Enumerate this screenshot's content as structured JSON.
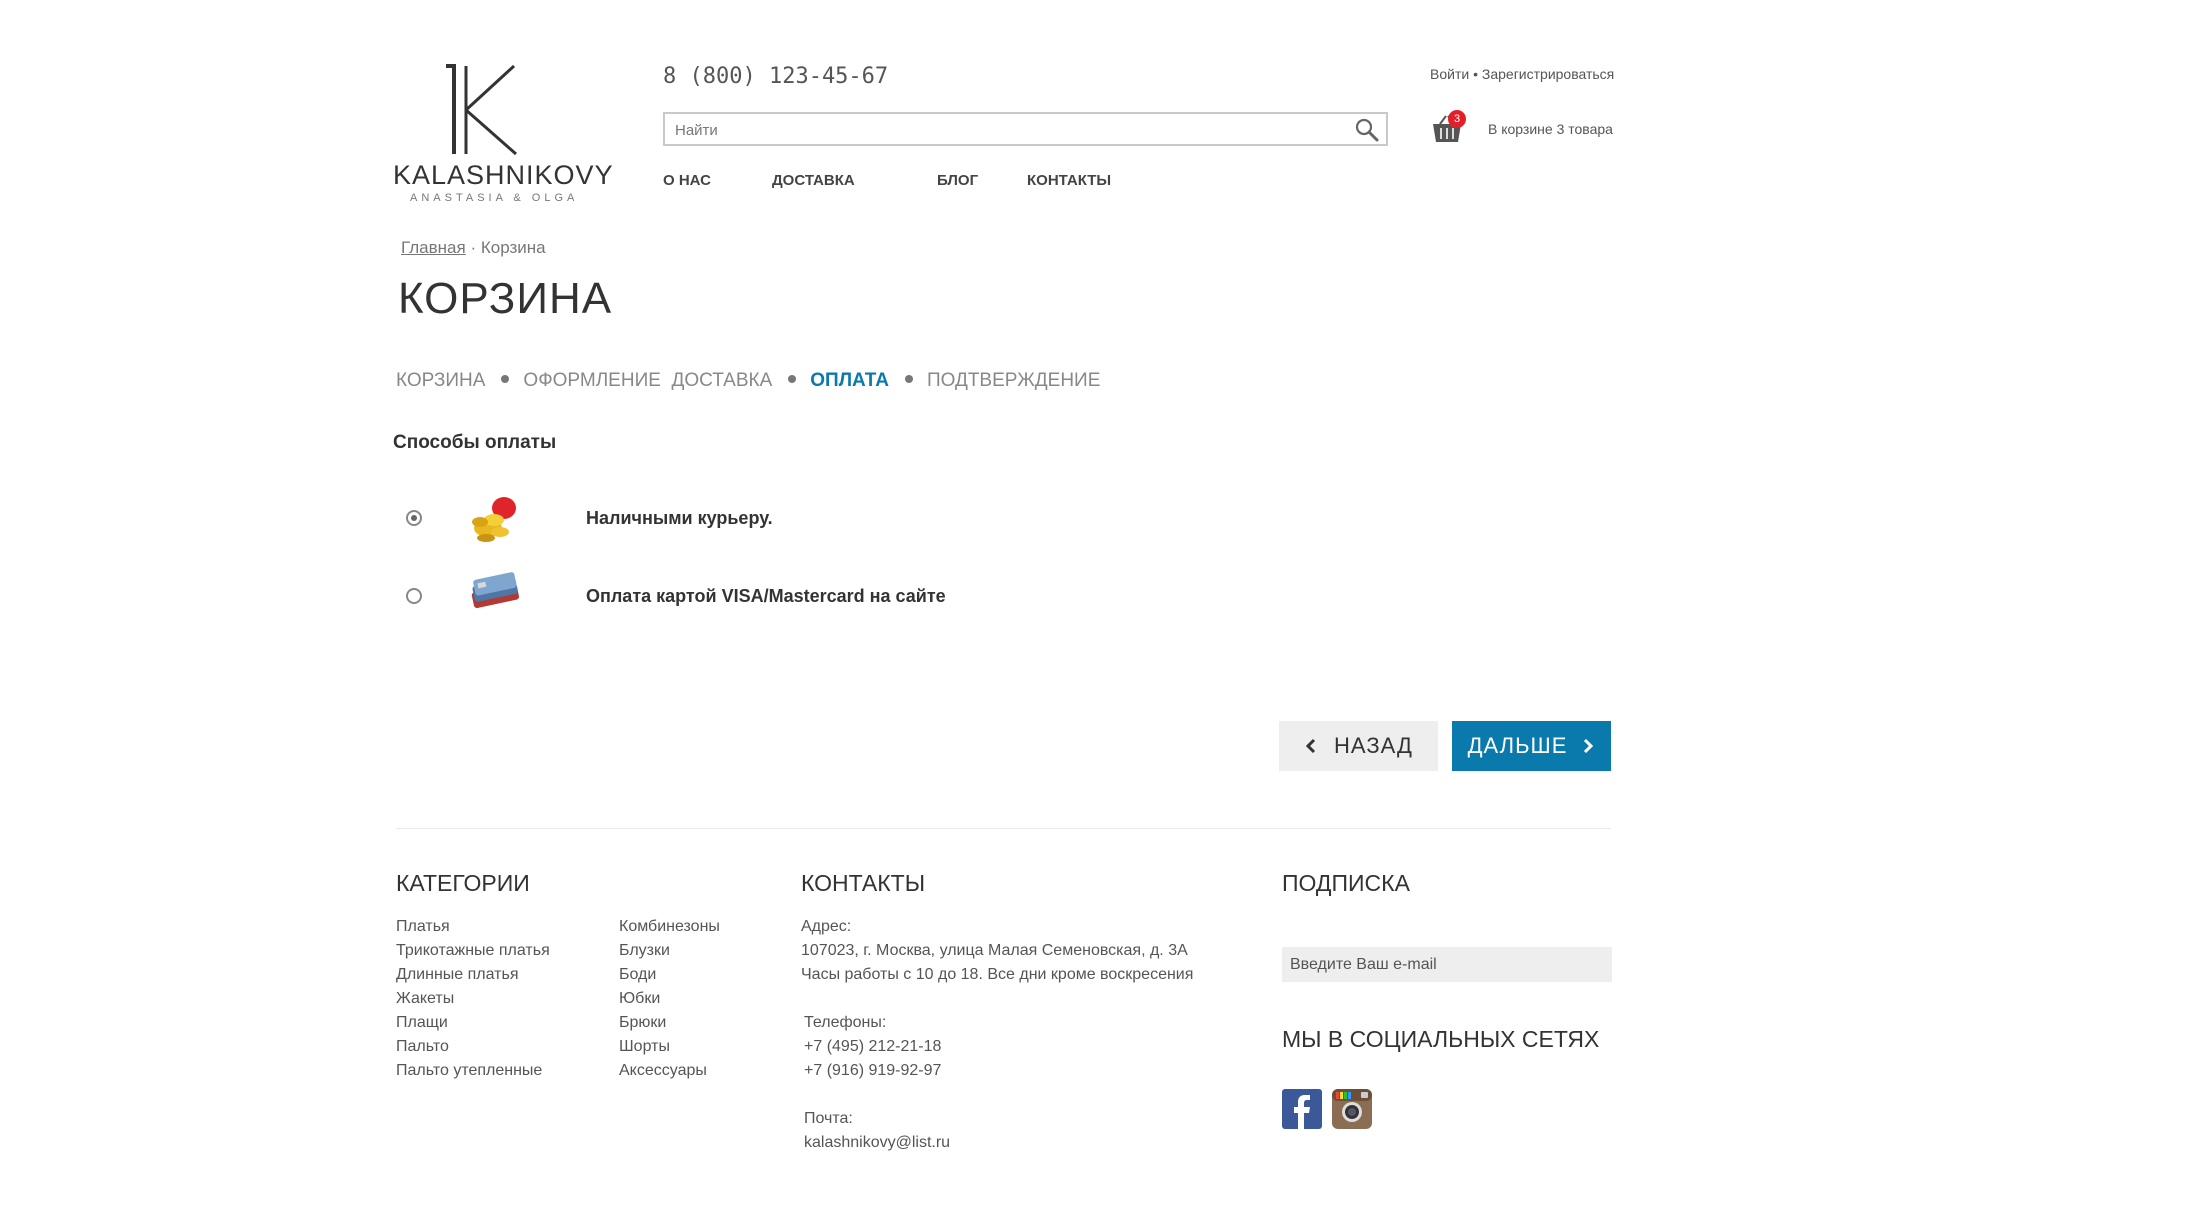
{
  "logo": {
    "name": "KALASHNIKOVY",
    "subtitle": "ANASTASIA & OLGA"
  },
  "header": {
    "phone": "8 (800) 123-45-67",
    "search_placeholder": "Найти",
    "login": "Войти",
    "separator": "•",
    "register": "Зарегистрироваться",
    "cart_count": "3",
    "cart_text": "В корзине 3 товара"
  },
  "nav": [
    "О НАС",
    "ДОСТАВКА",
    "БЛОГ",
    "КОНТАКТЫ"
  ],
  "breadcrumb": {
    "home": "Главная",
    "sep": "·",
    "current": "Корзина"
  },
  "page_title": "КОРЗИНА",
  "steps": [
    {
      "label": "КОРЗИНА",
      "active": false
    },
    {
      "label": "ОФОРМЛЕНИЕ  ДОСТАВКА",
      "active": false
    },
    {
      "label": "ОПЛАТА",
      "active": true
    },
    {
      "label": "ПОДТВЕРЖДЕНИЕ",
      "active": false
    }
  ],
  "payment": {
    "heading": "Способы оплаты",
    "methods": [
      {
        "label": "Наличными курьеру.",
        "selected": true,
        "icon": "coins-icon"
      },
      {
        "label": "Оплата картой VISA/Mastercard на сайте",
        "selected": false,
        "icon": "cards-icon"
      }
    ]
  },
  "buttons": {
    "back": "НАЗАД",
    "next": "ДАЛЬШЕ"
  },
  "footer": {
    "categories_title": "КАТЕГОРИИ",
    "categories_col1": [
      "Платья",
      "Трикотажные платья",
      "Длинные платья",
      "Жакеты",
      "Плащи",
      "Пальто",
      "Пальто утепленные"
    ],
    "categories_col2": [
      "Комбинезоны",
      "Блузки",
      "Боди",
      "Юбки",
      "Брюки",
      "Шорты",
      "Аксессуары"
    ],
    "contacts_title": "КОНТАКТЫ",
    "address_label": "Адрес:",
    "address": "107023, г. Москва, улица Малая Семеновская, д. 3А",
    "hours": "Часы работы с 10 до 18. Все дни кроме воскресения",
    "phones_label": "Телефоны:",
    "phone1": "+7 (495) 212-21-18",
    "phone2": "+7 (916) 919-92-97",
    "mail_label": "Почта:",
    "mail": "kalashnikovy@list.ru",
    "subscribe_title": "ПОДПИСКА",
    "subscribe_placeholder": "Введите Ваш e-mail",
    "social_title": "МЫ В СОЦИАЛЬНЫХ СЕТЯХ",
    "social": [
      "facebook-icon",
      "instagram-icon"
    ]
  },
  "colors": {
    "accent": "#0a7aad",
    "badge": "#e2202a",
    "button_back_bg": "#eeeeee"
  }
}
